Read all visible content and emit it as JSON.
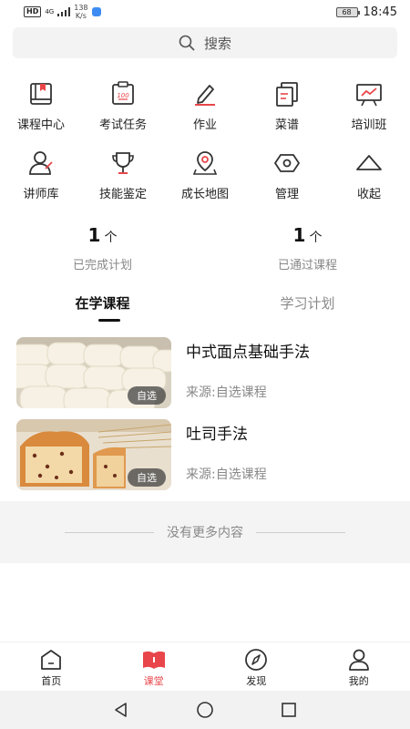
{
  "status_bar": {
    "hd": "HD",
    "signal": "4G",
    "speed_value": "138",
    "speed_unit": "K/s",
    "battery": "68",
    "time": "18:45"
  },
  "search": {
    "placeholder": "搜索"
  },
  "grid": {
    "row1": [
      {
        "label": "课程中心",
        "icon": "book-icon"
      },
      {
        "label": "考试任务",
        "icon": "exam-icon"
      },
      {
        "label": "作业",
        "icon": "pencil-icon"
      },
      {
        "label": "菜谱",
        "icon": "recipe-icon"
      },
      {
        "label": "培训班",
        "icon": "chart-board-icon"
      }
    ],
    "row2": [
      {
        "label": "讲师库",
        "icon": "teacher-icon"
      },
      {
        "label": "技能鉴定",
        "icon": "trophy-icon"
      },
      {
        "label": "成长地图",
        "icon": "map-pin-icon"
      },
      {
        "label": "管理",
        "icon": "hexagon-icon"
      },
      {
        "label": "收起",
        "icon": "collapse-icon"
      }
    ]
  },
  "stats": [
    {
      "value": "1",
      "unit": "个",
      "label": "已完成计划"
    },
    {
      "value": "1",
      "unit": "个",
      "label": "已通过课程"
    }
  ],
  "tabs": [
    {
      "label": "在学课程",
      "active": true
    },
    {
      "label": "学习计划",
      "active": false
    }
  ],
  "courses": [
    {
      "title": "中式面点基础手法",
      "source": "来源:自选课程",
      "tag": "自选"
    },
    {
      "title": "吐司手法",
      "source": "来源:自选课程",
      "tag": "自选"
    }
  ],
  "no_more": "没有更多内容",
  "bottom_nav": [
    {
      "label": "首页",
      "icon": "home-icon",
      "active": false
    },
    {
      "label": "课堂",
      "icon": "classroom-icon",
      "active": true
    },
    {
      "label": "发现",
      "icon": "compass-icon",
      "active": false
    },
    {
      "label": "我的",
      "icon": "user-icon",
      "active": false
    }
  ],
  "colors": {
    "accent": "#e8464a",
    "text": "#222222",
    "muted": "#888888",
    "search_bg": "#f3f3f3"
  }
}
